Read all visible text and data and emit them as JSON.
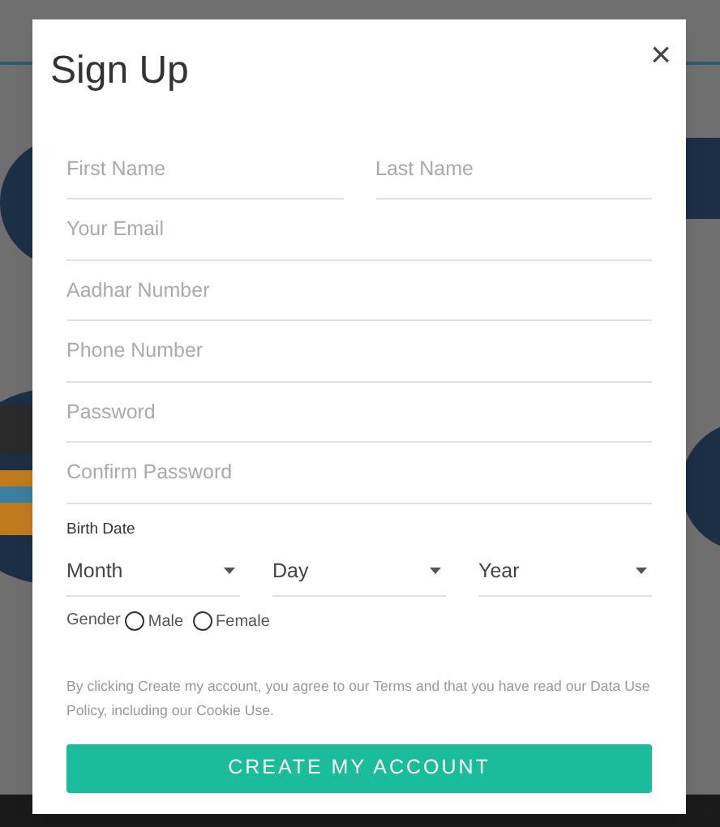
{
  "dialog": {
    "title": "Sign Up",
    "close": "×"
  },
  "name_fields": [
    {
      "placeholder": "First Name"
    },
    {
      "placeholder": "Last Name"
    }
  ],
  "fields": [
    {
      "placeholder": "Your Email"
    },
    {
      "placeholder": "Aadhar Number"
    },
    {
      "placeholder": "Phone Number"
    },
    {
      "placeholder": "Password"
    },
    {
      "placeholder": "Confirm Password"
    }
  ],
  "birth_date": {
    "label": "Birth Date",
    "selects": [
      {
        "value": "Month"
      },
      {
        "value": "Day"
      },
      {
        "value": "Year"
      }
    ]
  },
  "gender": {
    "label": "Gender",
    "options": [
      {
        "label": "Male",
        "selected": false
      },
      {
        "label": "Female",
        "selected": false
      }
    ]
  },
  "terms": "By clicking Create my account, you agree to our Terms and that you have read our Data Use Policy, including our Cookie Use.",
  "submit": "CREATE MY ACCOUNT"
}
